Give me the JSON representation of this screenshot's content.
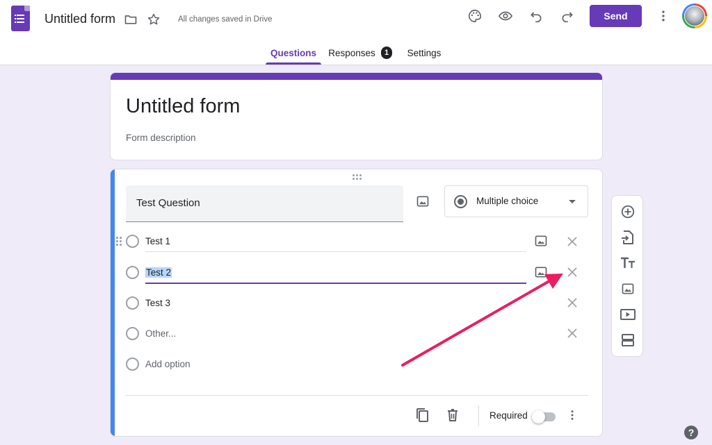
{
  "header": {
    "title": "Untitled form",
    "saved_status": "All changes saved in Drive",
    "send_label": "Send",
    "icons": [
      "forms-logo-icon",
      "folder-icon",
      "star-icon",
      "palette-icon",
      "preview-eye-icon",
      "undo-icon",
      "redo-icon",
      "more-vert-icon"
    ]
  },
  "tabs": [
    {
      "label": "Questions",
      "active": true
    },
    {
      "label": "Responses",
      "badge": "1"
    },
    {
      "label": "Settings"
    }
  ],
  "form": {
    "title": "Untitled form",
    "description_placeholder": "Form description"
  },
  "question": {
    "title": "Test Question",
    "type": "Multiple choice",
    "options": [
      "Test 1",
      "Test 2",
      "Test 3"
    ],
    "other_label": "Other...",
    "add_option_label": "Add option",
    "required_label": "Required",
    "required": false
  },
  "side_toolbar": [
    "add-question-icon",
    "import-questions-icon",
    "add-title-icon",
    "add-image-icon",
    "add-video-icon",
    "add-section-icon"
  ],
  "help": "?",
  "colors": {
    "accent": "#673ab7",
    "background": "#f0ebf8",
    "active_question": "#4285f4",
    "annotation_arrow": "#e91e63"
  }
}
